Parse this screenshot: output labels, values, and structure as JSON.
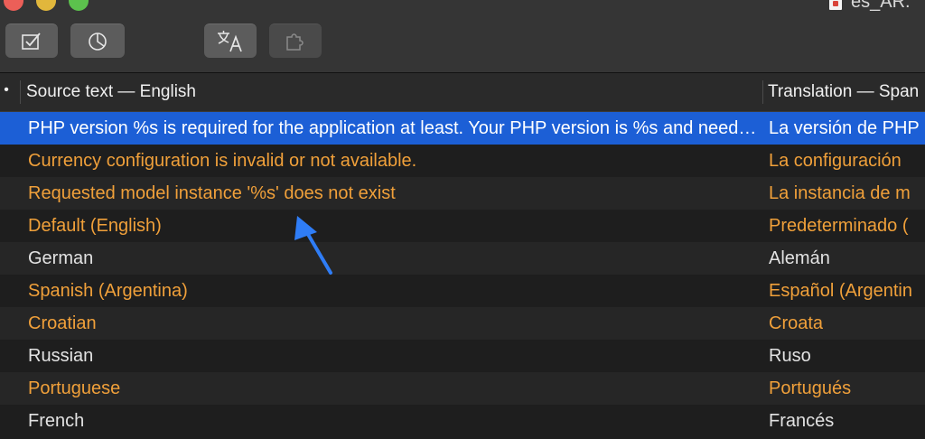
{
  "window": {
    "title": "es_AR."
  },
  "toolbar": {
    "buttons": [
      {
        "icon": "checkmark-box-icon",
        "enabled": true
      },
      {
        "icon": "pie-chart-icon",
        "enabled": true
      },
      {
        "icon": "translate-icon",
        "enabled": true
      },
      {
        "icon": "puzzle-icon",
        "enabled": false
      }
    ]
  },
  "table": {
    "columns": {
      "flag": "•",
      "source": "Source text — English",
      "translation": "Translation — Span"
    },
    "rows": [
      {
        "source": "PHP version %s is required for the application at least. Your PHP version is %s and needs to be updated.",
        "translation": "La versión de PHP",
        "state": "selected"
      },
      {
        "source": "Currency configuration is invalid or not available.",
        "translation": "La configuración",
        "state": "fuzzy"
      },
      {
        "source": "Requested model instance '%s' does not exist",
        "translation": "La instancia de m",
        "state": "fuzzy"
      },
      {
        "source": "Default (English)",
        "translation": "Predeterminado (",
        "state": "fuzzy"
      },
      {
        "source": "German",
        "translation": "Alemán",
        "state": "done"
      },
      {
        "source": "Spanish (Argentina)",
        "translation": "Español (Argentin",
        "state": "fuzzy"
      },
      {
        "source": "Croatian",
        "translation": "Croata",
        "state": "fuzzy"
      },
      {
        "source": "Russian",
        "translation": "Ruso",
        "state": "done"
      },
      {
        "source": "Portuguese",
        "translation": "Portugués",
        "state": "fuzzy"
      },
      {
        "source": "French",
        "translation": "Francés",
        "state": "done"
      }
    ]
  },
  "colors": {
    "fuzzy_text": "#f0a03a",
    "done_text": "#e2e2e2",
    "selection": "#1c5fd6",
    "annotation_arrow": "#2f7df6"
  }
}
